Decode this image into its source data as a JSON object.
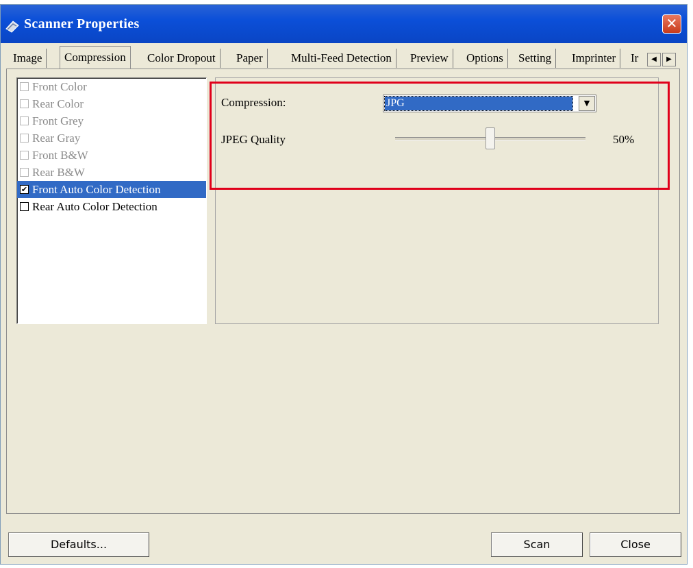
{
  "window": {
    "title": "Scanner Properties",
    "close_symbol": "✕"
  },
  "tabs": [
    {
      "label": "Image"
    },
    {
      "label": "Compression"
    },
    {
      "label": "Color Dropout"
    },
    {
      "label": "Paper"
    },
    {
      "label": "Multi-Feed Detection"
    },
    {
      "label": "Preview"
    },
    {
      "label": "Options"
    },
    {
      "label": "Setting"
    },
    {
      "label": "Imprinter"
    },
    {
      "label": "Ir"
    }
  ],
  "active_tab": "Compression",
  "tab_scroll": {
    "left": "◀",
    "right": "▶"
  },
  "image_list": [
    {
      "label": "Front Color",
      "checked": false,
      "state": "disabled"
    },
    {
      "label": "Rear Color",
      "checked": false,
      "state": "disabled"
    },
    {
      "label": "Front Grey",
      "checked": false,
      "state": "disabled"
    },
    {
      "label": "Rear Gray",
      "checked": false,
      "state": "disabled"
    },
    {
      "label": "Front B&W",
      "checked": false,
      "state": "disabled"
    },
    {
      "label": "Rear B&W",
      "checked": false,
      "state": "disabled"
    },
    {
      "label": "Front Auto Color Detection",
      "checked": true,
      "state": "selected"
    },
    {
      "label": "Rear Auto Color Detection",
      "checked": false,
      "state": "enabled"
    }
  ],
  "check_mark": "✔",
  "compression": {
    "label": "Compression:",
    "value": "JPG",
    "dropdown_arrow": "▼"
  },
  "jpeg_quality": {
    "label": "JPEG Quality",
    "value_text": "50%",
    "value": 50
  },
  "buttons": {
    "defaults": "Defaults...",
    "scan": "Scan",
    "close": "Close"
  },
  "colors": {
    "titlebar": "#0b4fd8",
    "selection": "#316ac5",
    "highlight_box": "#e0001b",
    "dialog_bg": "#ece9d8"
  }
}
